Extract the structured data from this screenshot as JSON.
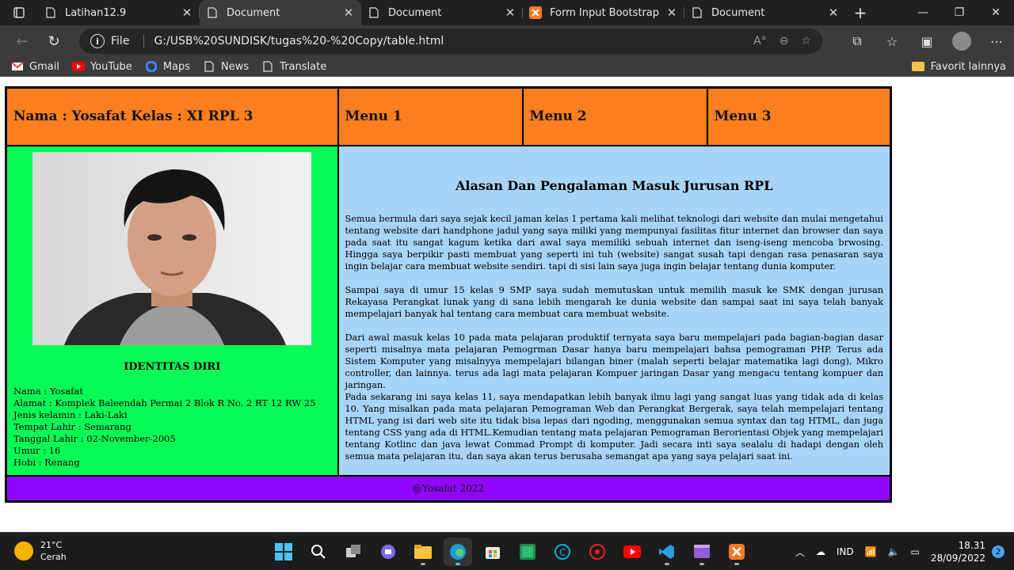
{
  "browser": {
    "tabs": [
      {
        "label": "Latihan12.9",
        "active": false,
        "icon": "page-icon"
      },
      {
        "label": "Document",
        "active": true,
        "icon": "page-icon"
      },
      {
        "label": "Document",
        "active": false,
        "icon": "page-icon"
      },
      {
        "label": "Form Input Bootstrap",
        "active": false,
        "icon": "xampp-icon"
      },
      {
        "label": "Document",
        "active": false,
        "icon": "page-icon"
      }
    ],
    "address": {
      "scheme_label": "File",
      "url": "G:/USB%20SUNDISK/tugas%20-%20Copy/table.html"
    },
    "bookmarks": [
      {
        "label": "Gmail",
        "icon": "gmail-icon"
      },
      {
        "label": "YouTube",
        "icon": "youtube-icon"
      },
      {
        "label": "Maps",
        "icon": "google-icon"
      },
      {
        "label": "News",
        "icon": "page-icon"
      },
      {
        "label": "Translate",
        "icon": "page-icon"
      }
    ],
    "other_favorites": "Favorit lainnya"
  },
  "page": {
    "header": {
      "name_class": "Nama : Yosafat Kelas : XI RPL 3",
      "menu1": "Menu 1",
      "menu2": "Menu 2",
      "menu3": "Menu 3"
    },
    "identity": {
      "title": "IDENTITAS DIRI",
      "items": [
        "Nama : Yosafat",
        "Alamat : Komplek Baleendah Permai 2 Blok R No. 2 RT 12 RW 25",
        "Jenis kelamin : Laki-Laki",
        "Tempat Lahir : Semarang",
        "Tanggal Lahir : 02-November-2005",
        "Umur : 16",
        "Hobi : Renang"
      ]
    },
    "article": {
      "title": "Alasan Dan Pengalaman Masuk Jurusan RPL",
      "paragraphs": [
        "Semua bermula dari saya sejak kecil jaman kelas 1 pertama kali melihat teknologi dari website dan mulai mengetahui tentang website dari handphone jadul yang saya miliki yang mempunyai fasilitas fitur internet dan browser dan saya pada saat itu sangat kagum ketika dari awal saya memiliki sebuah internet dan iseng-iseng mencoba brwosing. Hingga saya berpikir pasti membuat yang seperti ini tuh (website) sangat susah tapi dengan rasa penasaran saya ingin belajar cara membuat website sendiri. tapi di sisi lain saya juga ingin belajar tentang dunia komputer.",
        "Sampai saya di umur 15 kelas 9 SMP saya sudah memutuskan untuk memilih masuk ke SMK dengan jurusan Rekayasa Perangkat lunak yang di sana lebih mengarah ke dunia website dan sampai saat ini saya telah banyak mempelajari banyak hal tentang cara membuat cara membuat website.",
        "Dari awal masuk kelas 10 pada mata pelajaran produktif ternyata saya baru mempelajari pada bagian-bagian dasar seperti misalnya mata pelajaran Pemogrman Dasar hanya baru mempelajari bahsa pemograman PHP. Terus ada Sistem Komputer yang misalnyya mempelajari bilangan biner (malah seperti belajar matematika lagi dong), Mikro controller, dan lainnya. terus ada lagi mata pelajaran Kompuer jaringan Dasar yang mengacu tentang kompuer dan jaringan.",
        "Pada sekarang ini saya kelas 11, saya mendapatkan lebih banyak ilmu lagi yang sangat luas yang tidak ada di kelas 10. Yang misalkan pada mata pelajaran Pemograman Web dan Perangkat Bergerak, saya telah mempelajari tentang HTML yang isi dari web site itu tidak bisa lepas dari ngoding, menggunakan semua syntax dan tag HTML, dan juga tentang CSS yang ada di HTML.Kemudian tentang mata pelajaran Pemograman Berorientasi Objek yang mempelajari tentang Kotlinc dan java lewat Commad Prompt di komputer. Jadi secara inti saya sealalu di hadapi dengan oleh semua mata pelajaran itu, dan saya akan terus berusaha semangat apa yang saya pelajari saat ini."
      ]
    },
    "footer": "@Yosafat 2022"
  },
  "taskbar": {
    "weather_temp": "21°C",
    "weather_desc": "Cerah",
    "language": "IND",
    "time": "18.31",
    "date": "28/09/2022",
    "notifications": "2"
  },
  "colors": {
    "header_bg": "#fd7f1f",
    "left_bg": "#06fb56",
    "right_bg": "#a8d4f7",
    "footer_bg": "#8f06fe"
  }
}
